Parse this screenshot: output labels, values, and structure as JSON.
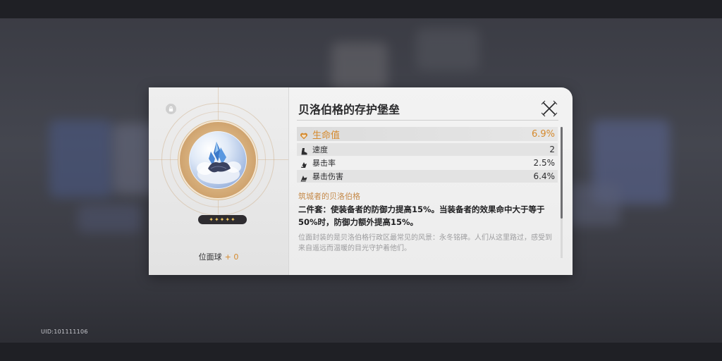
{
  "uid": "UID:101111106",
  "relic": {
    "title": "贝洛伯格的存护堡垒",
    "stars": "✦✦✦✦✦",
    "count_label": "位面球",
    "count_value": "+ 0",
    "main_stat": {
      "icon": "heart-icon",
      "name": "生命值",
      "value": "6.9%"
    },
    "sub_stats": [
      {
        "icon": "boot-icon",
        "name": "速度",
        "value": "2"
      },
      {
        "icon": "crit-rate-icon",
        "name": "暴击率",
        "value": "2.5%"
      },
      {
        "icon": "crit-damage-icon",
        "name": "暴击伤害",
        "value": "6.4%"
      }
    ],
    "set_name": "筑城者的贝洛伯格",
    "set_effect": "二件套：使装备者的防御力提高15%。当装备者的效果命中大于等于50%时，防御力额外提高15%。",
    "lore": "位面封装的是贝洛伯格行政区最常见的风景：永冬铭碑。人们从这里路过，感受到来自遥远而温暖的目光守护着他们。"
  },
  "colors": {
    "accent_orange": "#d58a2e",
    "set_name_color": "#c58a4a",
    "lore_gray": "#9d9d9f"
  }
}
